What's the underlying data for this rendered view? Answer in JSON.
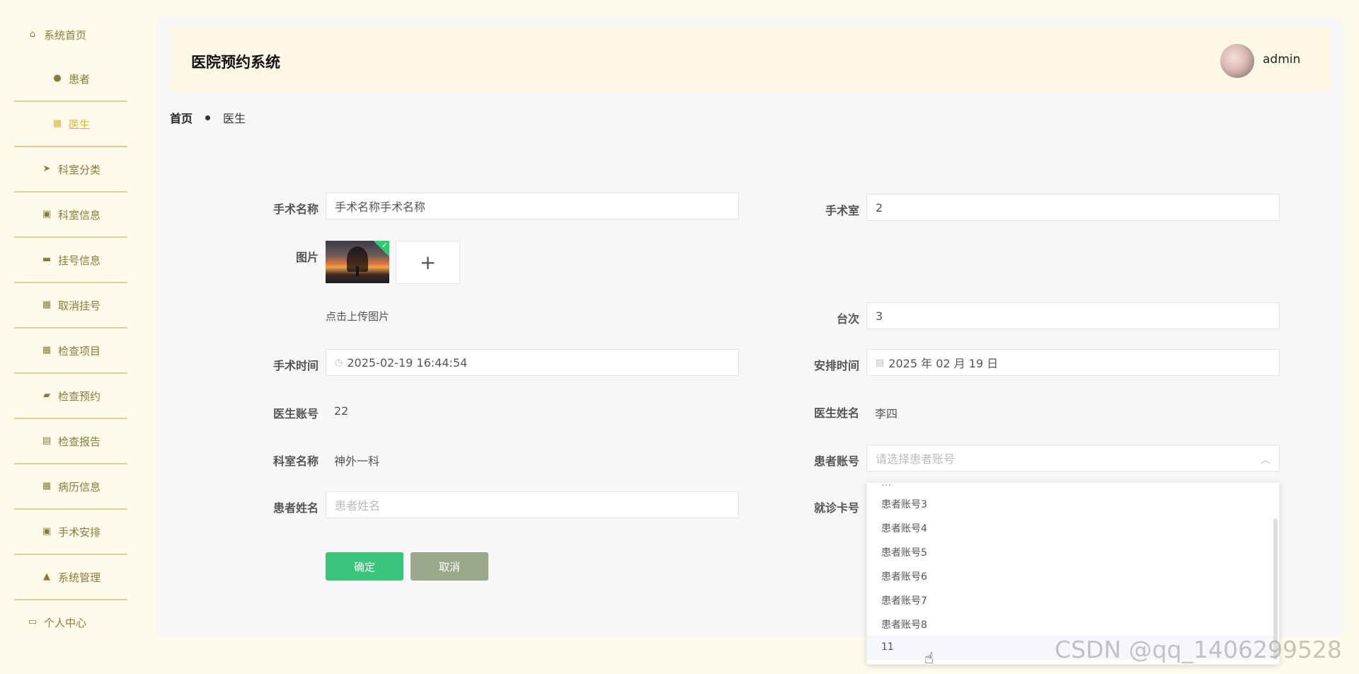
{
  "sidebar": {
    "items": [
      {
        "label": "系统首页",
        "icon": "home-icon",
        "glyph": "⌂"
      },
      {
        "label": "患者",
        "icon": "bulb-icon",
        "glyph": "●"
      },
      {
        "label": "医生",
        "icon": "grid-icon",
        "glyph": "▦"
      },
      {
        "label": "科室分类",
        "icon": "send-icon",
        "glyph": "➤"
      },
      {
        "label": "科室信息",
        "icon": "clipboard-icon",
        "glyph": "▣"
      },
      {
        "label": "挂号信息",
        "icon": "monitor-icon",
        "glyph": "▬"
      },
      {
        "label": "取消挂号",
        "icon": "grid-icon",
        "glyph": "▦"
      },
      {
        "label": "检查项目",
        "icon": "grid-icon",
        "glyph": "▦"
      },
      {
        "label": "检查预约",
        "icon": "ticket-icon",
        "glyph": "▰"
      },
      {
        "label": "检查报告",
        "icon": "clipboard-icon",
        "glyph": "▤"
      },
      {
        "label": "病历信息",
        "icon": "grid-icon",
        "glyph": "▦"
      },
      {
        "label": "手术安排",
        "icon": "clipboard-icon",
        "glyph": "▣"
      },
      {
        "label": "系统管理",
        "icon": "user-icon",
        "glyph": "▲"
      },
      {
        "label": "个人中心",
        "icon": "card-icon",
        "glyph": "▭"
      }
    ],
    "active_index": 2
  },
  "header": {
    "title": "医院预约系统",
    "user": "admin"
  },
  "breadcrumb": {
    "home": "首页",
    "current": "医生"
  },
  "form": {
    "surgery_name": {
      "label": "手术名称",
      "value": "手术名称手术名称"
    },
    "operating_room": {
      "label": "手术室",
      "value": "2"
    },
    "image": {
      "label": "图片",
      "hint": "点击上传图片",
      "add": "+"
    },
    "table_no": {
      "label": "台次",
      "value": "3"
    },
    "surgery_time": {
      "label": "手术时间",
      "value": "2025-02-19 16:44:54"
    },
    "schedule_time": {
      "label": "安排时间",
      "value": "2025 年 02 月 19 日"
    },
    "doctor_account": {
      "label": "医生账号",
      "value": "22"
    },
    "doctor_name": {
      "label": "医生姓名",
      "value": "李四"
    },
    "department_name": {
      "label": "科室名称",
      "value": "神外一科"
    },
    "patient_account": {
      "label": "患者账号",
      "placeholder": "请选择患者账号"
    },
    "patient_name": {
      "label": "患者姓名",
      "placeholder": "患者姓名"
    },
    "card_no": {
      "label": "就诊卡号"
    },
    "ok_label": "确定",
    "cancel_label": "取消"
  },
  "dropdown": {
    "options": [
      "患者账号3",
      "患者账号4",
      "患者账号5",
      "患者账号6",
      "患者账号7",
      "患者账号8",
      "11"
    ],
    "hovered": "11"
  },
  "watermark": "CSDN @qq_1406299528",
  "colors": {
    "accent": "#d4b53e",
    "ok": "#39c57a",
    "cancel": "#99a88a",
    "sidebar_bg": "#fffbeb",
    "header_bg": "#fdf8e6"
  }
}
